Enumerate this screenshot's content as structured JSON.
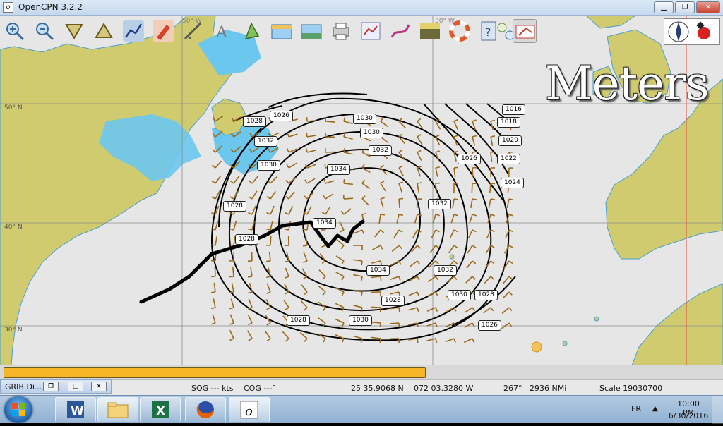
{
  "window": {
    "title": "OpenCPN 3.2.2",
    "minimize": "▁",
    "maximize": "❐",
    "close": "✕"
  },
  "colors": {
    "land": "#cfcb6e",
    "sea": "#e6e6e6",
    "shallow": "#6cc7ee",
    "wind": "#9a6a1a",
    "isobar": "#000000",
    "track": "#000000",
    "progress": "#f6b626"
  },
  "toolbar": {
    "tools": [
      {
        "name": "zoom-in",
        "icon": "zoom-in-icon"
      },
      {
        "name": "zoom-out",
        "icon": "zoom-out-icon"
      },
      {
        "name": "scale-in",
        "icon": "scale-in-icon"
      },
      {
        "name": "scale-out",
        "icon": "scale-out-icon"
      },
      {
        "name": "route",
        "icon": "route-icon"
      },
      {
        "name": "follow",
        "icon": "ship-icon"
      },
      {
        "name": "measure",
        "icon": "measure-icon"
      },
      {
        "name": "text",
        "icon": "text-icon"
      },
      {
        "name": "ais",
        "icon": "ais-icon"
      },
      {
        "name": "currents",
        "icon": "currents-icon"
      },
      {
        "name": "tides",
        "icon": "tides-icon"
      },
      {
        "name": "print",
        "icon": "print-icon"
      },
      {
        "name": "route-manager",
        "icon": "route-manager-icon"
      },
      {
        "name": "track",
        "icon": "track-icon"
      },
      {
        "name": "color-scheme",
        "icon": "color-scheme-icon"
      },
      {
        "name": "man-overboard",
        "icon": "lifebuoy-icon"
      },
      {
        "name": "help",
        "icon": "help-icon"
      },
      {
        "name": "settings",
        "icon": "settings-icon"
      },
      {
        "name": "grib",
        "icon": "grib-icon"
      }
    ]
  },
  "map": {
    "watermark": "Meters",
    "lat_labels": [
      "50° N",
      "40° N",
      "30° N"
    ],
    "lon_labels": [
      "50° W",
      "30° W"
    ]
  },
  "isobar_labels": [
    "1026",
    "1028",
    "1030",
    "1030",
    "1032",
    "1034",
    "1034",
    "1032",
    "1028",
    "1030",
    "1032",
    "1034",
    "1032",
    "1030",
    "1028",
    "1028",
    "1030",
    "1028",
    "1016",
    "1018",
    "1020",
    "1022",
    "1024",
    "1026",
    "1028",
    "1026"
  ],
  "grib_window": {
    "title": "GRIB Di..."
  },
  "status": {
    "sog": "SOG --- kts",
    "cog": "COG ---°",
    "lat": "25 35.9068 N",
    "lon": "072 03.3280 W",
    "bearing": "267°",
    "distance": "2936 NMi",
    "scale": "Scale 19030700"
  },
  "progress": {
    "fraction": 0.59
  },
  "taskbar": {
    "apps": [
      {
        "name": "word",
        "icon": "word-icon"
      },
      {
        "name": "explorer",
        "icon": "folder-icon"
      },
      {
        "name": "excel",
        "icon": "excel-icon"
      },
      {
        "name": "firefox",
        "icon": "firefox-icon"
      },
      {
        "name": "opencpn",
        "icon": "opencpn-icon"
      }
    ],
    "lang": "FR",
    "tray_arrow": "▲",
    "time": "10:00 PM",
    "date": "6/30/2016"
  }
}
